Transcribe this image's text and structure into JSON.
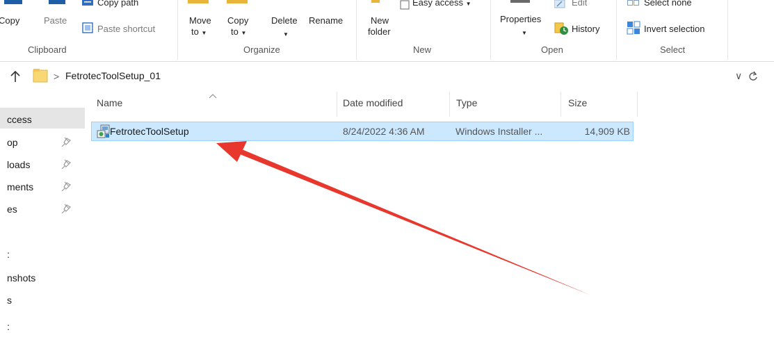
{
  "ribbon": {
    "clipboard": {
      "copy_label": "Copy",
      "paste_label": "Paste",
      "copy_path_label": "Copy path",
      "paste_shortcut_label": "Paste shortcut",
      "group_label": "Clipboard"
    },
    "organize": {
      "move_to_label": "Move",
      "move_to_sub": "to",
      "copy_to_label": "Copy",
      "copy_to_sub": "to",
      "delete_label": "Delete",
      "rename_label": "Rename",
      "group_label": "Organize"
    },
    "new": {
      "new_folder_label": "New",
      "new_folder_sub": "folder",
      "easy_access_label": "Easy access",
      "group_label": "New"
    },
    "open": {
      "properties_label": "Properties",
      "edit_label": "Edit",
      "history_label": "History",
      "group_label": "Open"
    },
    "select": {
      "select_none_label": "Select none",
      "invert_selection_label": "Invert selection",
      "group_label": "Select"
    }
  },
  "address": {
    "path": "FetrotecToolSetup_01",
    "separator": ">"
  },
  "nav": {
    "items": [
      {
        "label": "ccess",
        "pinned": false,
        "selected": true
      },
      {
        "label": "op",
        "pinned": true
      },
      {
        "label": "loads",
        "pinned": true
      },
      {
        "label": "ments",
        "pinned": true
      },
      {
        "label": "es",
        "pinned": true
      },
      {
        "label": ":",
        "pinned": false
      },
      {
        "label": "nshots",
        "pinned": false
      },
      {
        "label": "s",
        "pinned": false
      },
      {
        "label": ":",
        "pinned": false
      }
    ]
  },
  "columns": {
    "name": "Name",
    "date_modified": "Date modified",
    "type": "Type",
    "size": "Size"
  },
  "files": [
    {
      "name": "FetrotecToolSetup",
      "date_modified": "8/24/2022 4:36 AM",
      "type": "Windows Installer ...",
      "size": "14,909 KB",
      "icon": "msi-installer-icon",
      "selected": true
    }
  ],
  "colors": {
    "selection_fill": "#cce8ff",
    "selection_border": "#99d1ff",
    "annotation_arrow": "#e8372c"
  }
}
